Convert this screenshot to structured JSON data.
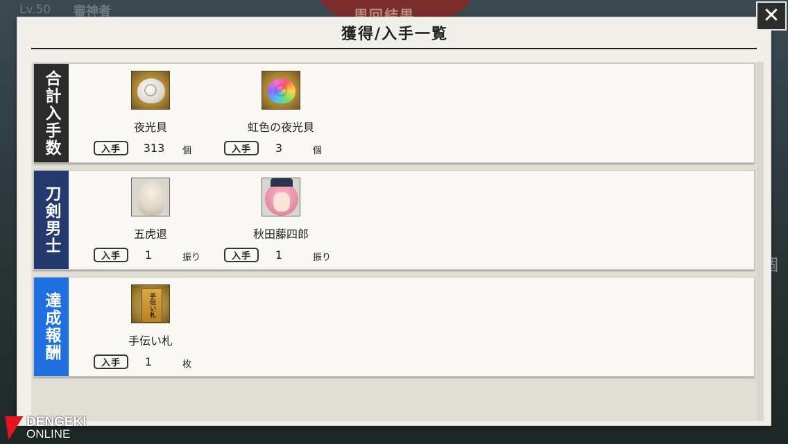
{
  "background": {
    "level": "Lv.50",
    "player_name": "審神者",
    "screen_title": "周回結果",
    "right_char": "個"
  },
  "modal": {
    "title": "獲得/入手一覧",
    "close_label": "✕"
  },
  "sections": [
    {
      "label": "合計入手数",
      "color": "#2b2b2b",
      "items": [
        {
          "name": "夜光貝",
          "badge": "入手",
          "count": "313",
          "unit": "個",
          "icon": "white-shell-icon"
        },
        {
          "name": "虹色の夜光貝",
          "badge": "入手",
          "count": "3",
          "unit": "個",
          "icon": "rainbow-shell-icon"
        }
      ]
    },
    {
      "label": "刀剣男士",
      "color": "#243a6e",
      "items": [
        {
          "name": "五虎退",
          "badge": "入手",
          "count": "1",
          "unit": "振り",
          "icon": "gokotai-portrait-icon"
        },
        {
          "name": "秋田藤四郎",
          "badge": "入手",
          "count": "1",
          "unit": "振り",
          "icon": "akita-portrait-icon"
        }
      ]
    },
    {
      "label": "達成報酬",
      "color": "#1f6fe0",
      "items": [
        {
          "name": "手伝い札",
          "badge": "入手",
          "count": "1",
          "unit": "枚",
          "icon": "help-tag-icon",
          "tag_text": "手伝い札"
        }
      ]
    }
  ],
  "watermark": {
    "line1": "DENGEKI",
    "line2": "ONLINE"
  }
}
